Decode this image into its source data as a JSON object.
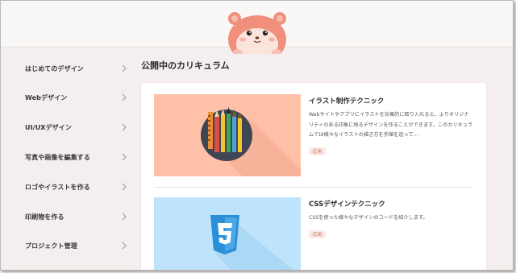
{
  "mascot": {
    "icon": "hamster-mascot-icon"
  },
  "sidebar": {
    "items": [
      {
        "label": "はじめてのデザイン"
      },
      {
        "label": "Webデザイン"
      },
      {
        "label": "UI/UXデザイン"
      },
      {
        "label": "写真や画像を編集する"
      },
      {
        "label": "ロゴやイラストを作る"
      },
      {
        "label": "印刷物を作る"
      },
      {
        "label": "プロジェクト管理"
      }
    ],
    "chevron_icon": "chevron-right-icon"
  },
  "main": {
    "section_title": "公開中のカリキュラム",
    "courses": [
      {
        "title": "イラスト制作テクニック",
        "description": "Webサイトやアプリにイラストを効果的に取り入れると、よりオリジナリティのある印象に残るデザインを作ることができます。このカリキュラムでは様々なイラストの描き方を手順を追って…",
        "tag": "応用",
        "thumb_icon": "pens-and-brushes-icon",
        "thumb_color": "#ffc0a8"
      },
      {
        "title": "CSSデザインテクニック",
        "description": "CSSを使った様々なデザインのコードを紹介します。",
        "tag": "応用",
        "thumb_icon": "css3-logo-icon",
        "thumb_color": "#bfe3fb"
      }
    ]
  },
  "colors": {
    "background": "#f4efee",
    "card": "#ffffff",
    "tag_text": "#c0685a",
    "tag_bg": "#fbe8e4",
    "css_blue": "#2a8fd6"
  }
}
